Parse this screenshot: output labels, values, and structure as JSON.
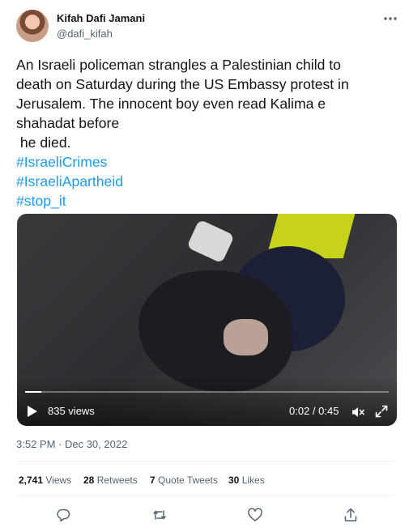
{
  "author": {
    "display_name": "Kifah Dafi Jamani",
    "handle": "@dafi_kifah"
  },
  "tweet": {
    "lines": [
      "An Israeli policeman strangles a Palestinian child to",
      "death on Saturday during the US Embassy protest in",
      "Jerusalem. The innocent boy even read Kalima e",
      "shahadat before",
      " he died."
    ],
    "hashtags": [
      "#IsraeliCrimes",
      "#IsraeliApartheid",
      "#stop_it"
    ]
  },
  "video": {
    "views": "835 views",
    "time": "0:02 / 0:45",
    "progress_fraction": 0.044
  },
  "timestamp": "3:52 PM · Dec 30, 2022",
  "stats": {
    "views_count": "2,741",
    "views_label": "Views",
    "retweets_count": "28",
    "retweets_label": "Retweets",
    "quotes_count": "7",
    "quotes_label": "Quote Tweets",
    "likes_count": "30",
    "likes_label": "Likes"
  },
  "colors": {
    "accent": "#1d9bf0",
    "text": "#0f1419",
    "secondary": "#536471"
  },
  "icons": {
    "more": "more-horizontal-icon",
    "play": "play-icon",
    "mute": "muted-speaker-icon",
    "expand": "expand-icon",
    "reply": "reply-icon",
    "retweet": "retweet-icon",
    "like": "heart-icon",
    "share": "share-icon"
  }
}
